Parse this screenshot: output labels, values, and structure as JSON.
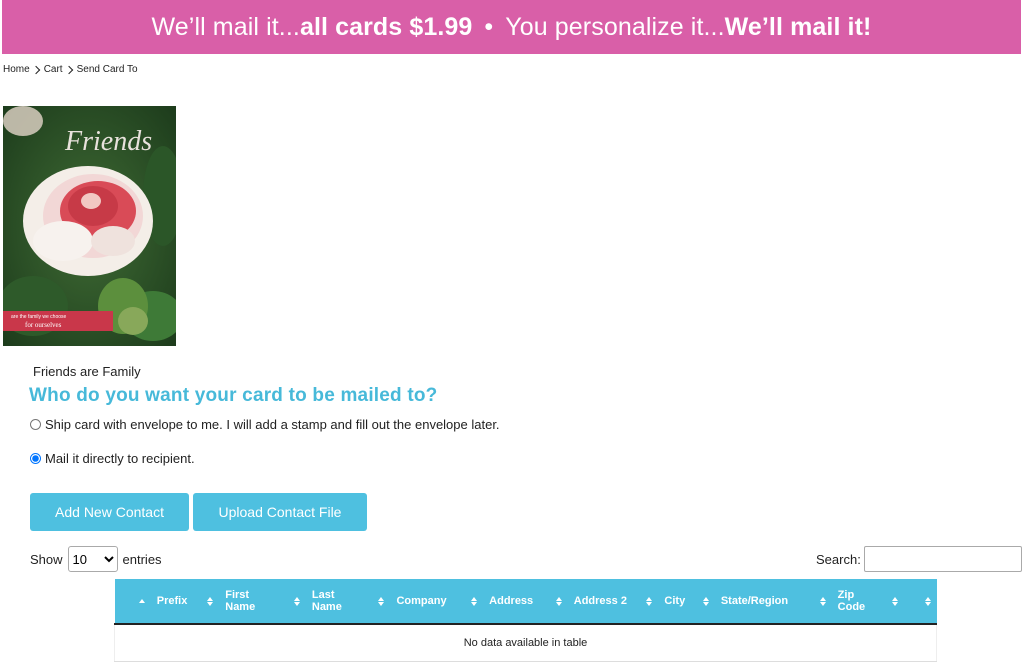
{
  "banner": {
    "part1": "We’ll mail it...",
    "part2": "all cards $1.99",
    "separator": "•",
    "part3": "You personalize it...",
    "part4": "We’ll mail it!"
  },
  "breadcrumb": {
    "items": [
      "Home",
      "Cart",
      "Send Card To"
    ]
  },
  "card": {
    "image_icon": "friends-card-image",
    "image_text_title": "Friends",
    "image_text_line1": "are the family we choose",
    "image_text_line2": "for ourselves",
    "name": "Friends are Family"
  },
  "heading": "Who do you want your card to be mailed to?",
  "options": {
    "ship_label": "Ship card with envelope to me. I will add a stamp and fill out the envelope later.",
    "mail_label": "Mail it directly to recipient.",
    "selected": "mail"
  },
  "buttons": {
    "add_contact": "Add New Contact",
    "upload_contact": "Upload Contact File"
  },
  "table_controls": {
    "show_label": "Show",
    "entries_value": "10",
    "entries_label": "entries",
    "search_label": "Search:",
    "search_value": ""
  },
  "table": {
    "headers": [
      "",
      "Prefix",
      "First Name",
      "Last Name",
      "Company",
      "Address",
      "Address 2",
      "City",
      "State/Region",
      "Zip Code",
      ""
    ],
    "empty_message": "No data available in table"
  },
  "colors": {
    "banner": "#d95fa8",
    "accent": "#47b9d9",
    "button": "#4ec0e0"
  }
}
